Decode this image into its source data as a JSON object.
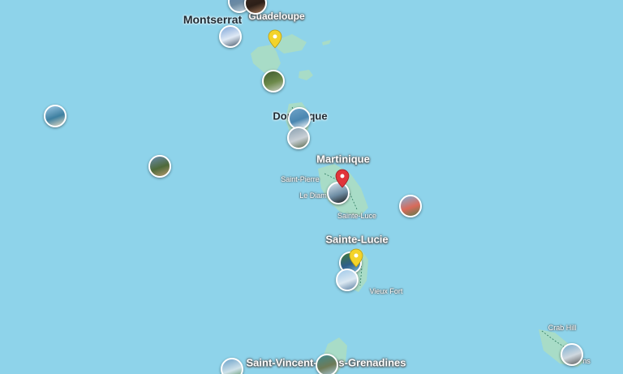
{
  "labels": {
    "montserrat": "Montserrat",
    "guadeloupe": "Guadeloupe",
    "dominique": "Dominique",
    "martinique": "Martinique",
    "saint_pierre": "Saint-Pierre",
    "le_diamant": "Le Diam",
    "sainte_luce": "Sainte-Luce",
    "sainte_lucie": "Sainte-Lucie",
    "vieux_fort": "Vieux Fort",
    "crab_hill": "Crab Hill",
    "saint_vincent": "Saint-Vincent-et-les-Grenadines",
    "barbuda_partial": "ns"
  },
  "colors": {
    "sea": "#8ed3ea",
    "land": "#a8dcc7",
    "pin_yellow": "#f3d32a",
    "pin_red": "#e0343a"
  },
  "photos": [
    {
      "theme": "sea-cliff",
      "colors": [
        "#5a7fa8",
        "#c9d7e0",
        "#6b8aa3"
      ]
    },
    {
      "theme": "interior-arches",
      "colors": [
        "#3b2a22",
        "#a77a5a",
        "#2c1f18"
      ]
    },
    {
      "theme": "volcano",
      "colors": [
        "#7fa6d8",
        "#4a5a6b",
        "#dfe9f5"
      ]
    },
    {
      "theme": "waterfall",
      "colors": [
        "#3e5a2f",
        "#c9cfc6",
        "#6d8a4a"
      ]
    },
    {
      "theme": "beach",
      "colors": [
        "#9ec9e6",
        "#e8dcc4",
        "#3d7fa0"
      ]
    },
    {
      "theme": "lagoon",
      "colors": [
        "#6fa3c8",
        "#ffffff",
        "#4a86b0"
      ]
    },
    {
      "theme": "coast",
      "colors": [
        "#8aa0b0",
        "#5a6a4e",
        "#c9d0d6"
      ]
    },
    {
      "theme": "village",
      "colors": [
        "#6a8cb0",
        "#b89a70",
        "#4e6a3a"
      ]
    },
    {
      "theme": "palm",
      "colors": [
        "#d8e6ee",
        "#1c1c1c",
        "#6e8da4"
      ]
    },
    {
      "theme": "pitons",
      "colors": [
        "#7fb0d8",
        "#5a7a4a",
        "#d96a5a"
      ]
    },
    {
      "theme": "bay",
      "colors": [
        "#3f7a3a",
        "#7ec0e0",
        "#2f5f8a"
      ]
    },
    {
      "theme": "sailboat",
      "colors": [
        "#9fc8e8",
        "#5b7ea0",
        "#dbe8f2"
      ]
    },
    {
      "theme": "harbour",
      "colors": [
        "#7aaed0",
        "#5a5a5a",
        "#cfd8df"
      ]
    },
    {
      "theme": "reef",
      "colors": [
        "#6aa0c8",
        "#4a8a5a",
        "#cfe2ea"
      ]
    },
    {
      "theme": "shore",
      "colors": [
        "#3f8a90",
        "#a8c9d8",
        "#6e7a56"
      ]
    }
  ],
  "pins": [
    {
      "color": "yellow"
    },
    {
      "color": "red"
    },
    {
      "color": "yellow"
    }
  ]
}
